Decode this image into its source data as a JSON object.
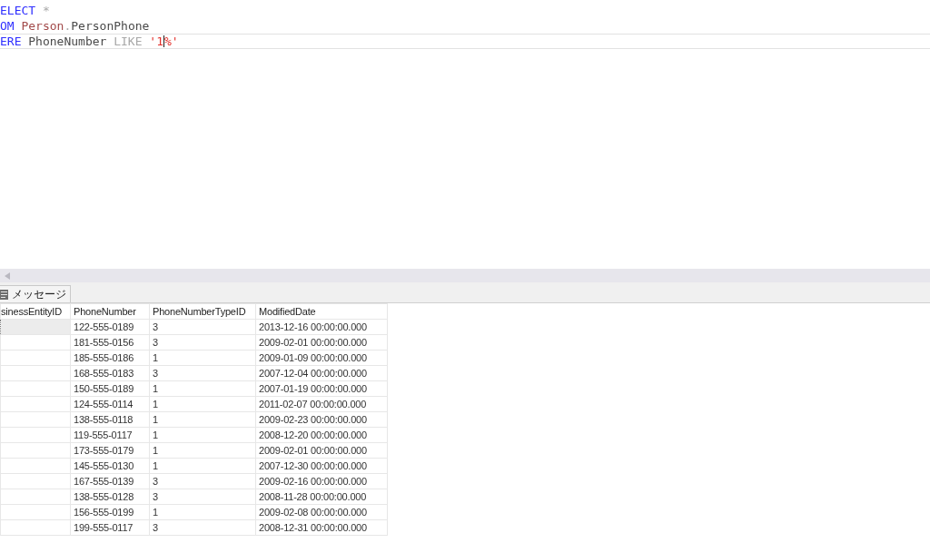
{
  "editor": {
    "lines": [
      {
        "current": false,
        "words": [
          [
            {
              "kind": "keyword",
              "text": "ELECT"
            }
          ],
          [
            {
              "kind": "operator",
              "text": "*"
            }
          ]
        ]
      },
      {
        "current": false,
        "words": [
          [
            {
              "kind": "keyword",
              "text": "OM"
            }
          ],
          [
            {
              "kind": "schema",
              "text": "Person"
            },
            {
              "kind": "operator",
              "text": "."
            },
            {
              "kind": "identifier",
              "text": "PersonPhone"
            }
          ]
        ]
      },
      {
        "current": true,
        "words": [
          [
            {
              "kind": "keyword",
              "text": "ERE"
            }
          ],
          [
            {
              "kind": "identifier",
              "text": "PhoneNumber"
            }
          ],
          [
            {
              "kind": "operator",
              "text": "LIKE"
            }
          ],
          [
            {
              "kind": "string",
              "text": "'1"
            },
            {
              "kind": "cursor"
            },
            {
              "kind": "string",
              "text": "%'"
            }
          ]
        ]
      }
    ]
  },
  "results": {
    "tabs": [
      {
        "label": "メッセージ",
        "selected": false
      }
    ],
    "columns": [
      "sinessEntityID",
      "PhoneNumber",
      "PhoneNumberTypeID",
      "ModifiedDate"
    ],
    "rows": [
      {
        "selected": true,
        "cells": [
          "",
          "122-555-0189",
          "3",
          "2013-12-16 00:00:00.000"
        ]
      },
      {
        "selected": false,
        "cells": [
          "",
          "181-555-0156",
          "3",
          "2009-02-01 00:00:00.000"
        ]
      },
      {
        "selected": false,
        "cells": [
          "",
          "185-555-0186",
          "1",
          "2009-01-09 00:00:00.000"
        ]
      },
      {
        "selected": false,
        "cells": [
          "",
          "168-555-0183",
          "3",
          "2007-12-04 00:00:00.000"
        ]
      },
      {
        "selected": false,
        "cells": [
          "",
          "150-555-0189",
          "1",
          "2007-01-19 00:00:00.000"
        ]
      },
      {
        "selected": false,
        "cells": [
          "",
          "124-555-0114",
          "1",
          "2011-02-07 00:00:00.000"
        ]
      },
      {
        "selected": false,
        "cells": [
          "",
          "138-555-0118",
          "1",
          "2009-02-23 00:00:00.000"
        ]
      },
      {
        "selected": false,
        "cells": [
          "",
          "119-555-0117",
          "1",
          "2008-12-20 00:00:00.000"
        ]
      },
      {
        "selected": false,
        "cells": [
          "",
          "173-555-0179",
          "1",
          "2009-02-01 00:00:00.000"
        ]
      },
      {
        "selected": false,
        "cells": [
          "",
          "145-555-0130",
          "1",
          "2007-12-30 00:00:00.000"
        ]
      },
      {
        "selected": false,
        "cells": [
          "",
          "167-555-0139",
          "3",
          "2009-02-16 00:00:00.000"
        ]
      },
      {
        "selected": false,
        "cells": [
          "",
          "138-555-0128",
          "3",
          "2008-11-28 00:00:00.000"
        ]
      },
      {
        "selected": false,
        "cells": [
          "",
          "156-555-0199",
          "1",
          "2009-02-08 00:00:00.000"
        ]
      },
      {
        "selected": false,
        "cells": [
          "",
          "199-555-0117",
          "3",
          "2008-12-31 00:00:00.000"
        ]
      }
    ]
  }
}
